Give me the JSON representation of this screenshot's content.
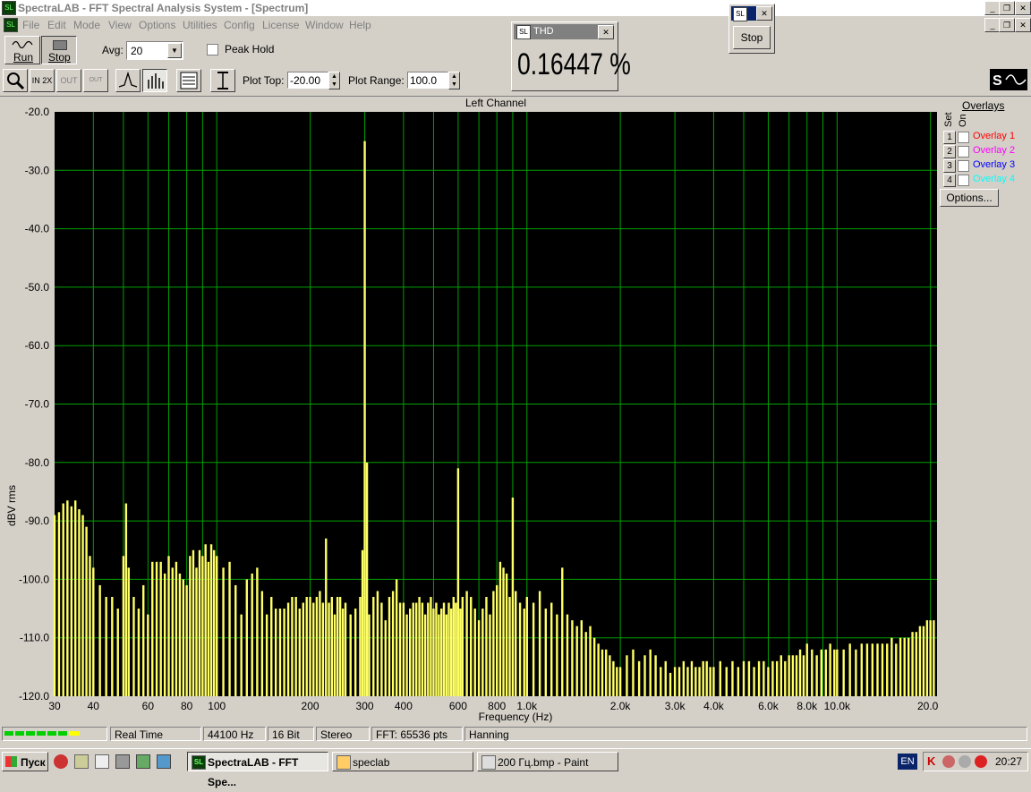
{
  "window": {
    "title": "SpectraLAB - FFT Spectral Analysis System - [Spectrum]"
  },
  "menu": [
    "File",
    "Edit",
    "Mode",
    "View",
    "Options",
    "Utilities",
    "Config",
    "License",
    "Window",
    "Help"
  ],
  "toolbar": {
    "run_label": "Run",
    "stop_label": "Stop",
    "avg_label": "Avg:",
    "avg_value": "20",
    "peak_hold_label": "Peak Hold",
    "plot_top_label": "Plot Top:",
    "plot_top_value": "-20.00",
    "plot_range_label": "Plot Range:",
    "plot_range_value": "100.0",
    "zoom_in_label": "IN 2X",
    "zoom_out_label": "OUT 2X",
    "zoom_full_label": "OUT FULL"
  },
  "thd_window": {
    "title": "THD",
    "value": "0.16447 %"
  },
  "stop_window": {
    "stop_label": "Stop"
  },
  "plot": {
    "channel_title": "Left Channel",
    "colors": {
      "background": "#000000",
      "grid": "#00a000",
      "bars": "#ffff66"
    }
  },
  "overlays": {
    "title": "Overlays",
    "set_label": "Set",
    "on_label": "On",
    "items": [
      {
        "num": "1",
        "label": "Overlay 1",
        "color": "#ff0000"
      },
      {
        "num": "2",
        "label": "Overlay 2",
        "color": "#ff00ff"
      },
      {
        "num": "3",
        "label": "Overlay 3",
        "color": "#0000ff"
      },
      {
        "num": "4",
        "label": "Overlay 4",
        "color": "#00ffff"
      }
    ],
    "options_label": "Options..."
  },
  "status": {
    "mode": "Real Time",
    "rate": "44100 Hz",
    "bits": "16 Bit",
    "channels": "Stereo",
    "fft": "FFT: 65536 pts",
    "window": "Hanning"
  },
  "taskbar": {
    "start": "Пуск",
    "tasks": [
      "SpectraLAB - FFT Spe...",
      "speclab",
      "200 Гц.bmp - Paint"
    ],
    "lang": "EN",
    "clock": "20:27"
  },
  "chart_data": {
    "type": "bar",
    "xscale": "log",
    "xlabel": "Frequency (Hz)",
    "ylabel": "dBV rms",
    "xlim": [
      30,
      21000
    ],
    "ylim": [
      -120,
      -20
    ],
    "grid": true,
    "yticks": [
      "-20.0",
      "-30.0",
      "-40.0",
      "-50.0",
      "-60.0",
      "-70.0",
      "-80.0",
      "-90.0",
      "-100.0",
      "-110.0",
      "-120.0"
    ],
    "xticks": [
      {
        "v": 30,
        "t": "30"
      },
      {
        "v": 40,
        "t": "40"
      },
      {
        "v": 60,
        "t": "60"
      },
      {
        "v": 80,
        "t": "80"
      },
      {
        "v": 100,
        "t": "100"
      },
      {
        "v": 200,
        "t": "200"
      },
      {
        "v": 300,
        "t": "300"
      },
      {
        "v": 400,
        "t": "400"
      },
      {
        "v": 600,
        "t": "600"
      },
      {
        "v": 800,
        "t": "800"
      },
      {
        "v": 1000,
        "t": "1.0k"
      },
      {
        "v": 2000,
        "t": "2.0k"
      },
      {
        "v": 3000,
        "t": "3.0k"
      },
      {
        "v": 4000,
        "t": "4.0k"
      },
      {
        "v": 6000,
        "t": "6.0k"
      },
      {
        "v": 8000,
        "t": "8.0k"
      },
      {
        "v": 10000,
        "t": "10.0k"
      },
      {
        "v": 20000,
        "t": "20.0k"
      }
    ],
    "bars": [
      [
        30,
        -89
      ],
      [
        31,
        -88.5
      ],
      [
        32,
        -87
      ],
      [
        33,
        -86.5
      ],
      [
        34,
        -87.5
      ],
      [
        35,
        -86.5
      ],
      [
        36,
        -88
      ],
      [
        37,
        -89
      ],
      [
        38,
        -91
      ],
      [
        39,
        -96
      ],
      [
        40,
        -98
      ],
      [
        42,
        -101
      ],
      [
        44,
        -103
      ],
      [
        46,
        -103
      ],
      [
        48,
        -105
      ],
      [
        50,
        -96
      ],
      [
        51,
        -87
      ],
      [
        52,
        -98
      ],
      [
        54,
        -103
      ],
      [
        56,
        -105
      ],
      [
        58,
        -101
      ],
      [
        60,
        -106
      ],
      [
        62,
        -97
      ],
      [
        64,
        -97
      ],
      [
        66,
        -97
      ],
      [
        68,
        -99
      ],
      [
        70,
        -96
      ],
      [
        72,
        -98
      ],
      [
        74,
        -97
      ],
      [
        76,
        -99
      ],
      [
        78,
        -100
      ],
      [
        80,
        -101
      ],
      [
        82,
        -96
      ],
      [
        84,
        -95
      ],
      [
        86,
        -98
      ],
      [
        88,
        -95
      ],
      [
        90,
        -96
      ],
      [
        92,
        -94
      ],
      [
        94,
        -97
      ],
      [
        96,
        -94
      ],
      [
        98,
        -95
      ],
      [
        100,
        -96
      ],
      [
        105,
        -98
      ],
      [
        110,
        -97
      ],
      [
        115,
        -101
      ],
      [
        120,
        -106
      ],
      [
        125,
        -100
      ],
      [
        130,
        -99
      ],
      [
        135,
        -98
      ],
      [
        140,
        -102
      ],
      [
        145,
        -106
      ],
      [
        150,
        -103
      ],
      [
        155,
        -105
      ],
      [
        160,
        -105
      ],
      [
        165,
        -105
      ],
      [
        170,
        -104
      ],
      [
        175,
        -103
      ],
      [
        180,
        -103
      ],
      [
        185,
        -105
      ],
      [
        190,
        -104
      ],
      [
        195,
        -103
      ],
      [
        200,
        -103
      ],
      [
        205,
        -104
      ],
      [
        210,
        -103
      ],
      [
        215,
        -102
      ],
      [
        220,
        -104
      ],
      [
        225,
        -93
      ],
      [
        230,
        -104
      ],
      [
        235,
        -103
      ],
      [
        240,
        -106
      ],
      [
        245,
        -103
      ],
      [
        250,
        -103
      ],
      [
        255,
        -105
      ],
      [
        260,
        -104
      ],
      [
        270,
        -106
      ],
      [
        280,
        -105
      ],
      [
        290,
        -103
      ],
      [
        295,
        -95
      ],
      [
        300,
        -25
      ],
      [
        305,
        -80
      ],
      [
        310,
        -106
      ],
      [
        320,
        -103
      ],
      [
        330,
        -102
      ],
      [
        340,
        -104
      ],
      [
        350,
        -107
      ],
      [
        360,
        -103
      ],
      [
        370,
        -102
      ],
      [
        380,
        -100
      ],
      [
        390,
        -104
      ],
      [
        400,
        -104
      ],
      [
        410,
        -106
      ],
      [
        420,
        -105
      ],
      [
        430,
        -104
      ],
      [
        440,
        -104
      ],
      [
        450,
        -103
      ],
      [
        460,
        -104
      ],
      [
        470,
        -106
      ],
      [
        480,
        -104
      ],
      [
        490,
        -103
      ],
      [
        500,
        -105
      ],
      [
        510,
        -104
      ],
      [
        520,
        -106
      ],
      [
        530,
        -105
      ],
      [
        540,
        -104
      ],
      [
        550,
        -106
      ],
      [
        560,
        -104
      ],
      [
        570,
        -105
      ],
      [
        580,
        -103
      ],
      [
        590,
        -104
      ],
      [
        600,
        -81
      ],
      [
        610,
        -105
      ],
      [
        620,
        -103
      ],
      [
        640,
        -102
      ],
      [
        660,
        -103
      ],
      [
        680,
        -105
      ],
      [
        700,
        -107
      ],
      [
        720,
        -105
      ],
      [
        740,
        -103
      ],
      [
        760,
        -106
      ],
      [
        780,
        -102
      ],
      [
        800,
        -101
      ],
      [
        820,
        -97
      ],
      [
        840,
        -98
      ],
      [
        860,
        -99
      ],
      [
        880,
        -103
      ],
      [
        900,
        -86
      ],
      [
        920,
        -102
      ],
      [
        950,
        -104
      ],
      [
        980,
        -105
      ],
      [
        1000,
        -103
      ],
      [
        1050,
        -104
      ],
      [
        1100,
        -102
      ],
      [
        1150,
        -105
      ],
      [
        1200,
        -104
      ],
      [
        1250,
        -106
      ],
      [
        1300,
        -98
      ],
      [
        1350,
        -106
      ],
      [
        1400,
        -107
      ],
      [
        1450,
        -108
      ],
      [
        1500,
        -107
      ],
      [
        1550,
        -109
      ],
      [
        1600,
        -108
      ],
      [
        1650,
        -110
      ],
      [
        1700,
        -111
      ],
      [
        1750,
        -112
      ],
      [
        1800,
        -112
      ],
      [
        1850,
        -113
      ],
      [
        1900,
        -114
      ],
      [
        1950,
        -115
      ],
      [
        2000,
        -115
      ],
      [
        2100,
        -113
      ],
      [
        2200,
        -112
      ],
      [
        2300,
        -114
      ],
      [
        2400,
        -113
      ],
      [
        2500,
        -112
      ],
      [
        2600,
        -113
      ],
      [
        2700,
        -115
      ],
      [
        2800,
        -114
      ],
      [
        2900,
        -116
      ],
      [
        3000,
        -115
      ],
      [
        3100,
        -115
      ],
      [
        3200,
        -114
      ],
      [
        3300,
        -115
      ],
      [
        3400,
        -114
      ],
      [
        3500,
        -115
      ],
      [
        3600,
        -115
      ],
      [
        3700,
        -114
      ],
      [
        3800,
        -114
      ],
      [
        3900,
        -115
      ],
      [
        4000,
        -115
      ],
      [
        4200,
        -114
      ],
      [
        4400,
        -115
      ],
      [
        4600,
        -114
      ],
      [
        4800,
        -115
      ],
      [
        5000,
        -114
      ],
      [
        5200,
        -114
      ],
      [
        5400,
        -115
      ],
      [
        5600,
        -114
      ],
      [
        5800,
        -114
      ],
      [
        6000,
        -115
      ],
      [
        6200,
        -114
      ],
      [
        6400,
        -114
      ],
      [
        6600,
        -113
      ],
      [
        6800,
        -114
      ],
      [
        7000,
        -113
      ],
      [
        7200,
        -113
      ],
      [
        7400,
        -113
      ],
      [
        7600,
        -112
      ],
      [
        7800,
        -113
      ],
      [
        8000,
        -111
      ],
      [
        8300,
        -112
      ],
      [
        8600,
        -113
      ],
      [
        8900,
        -112
      ],
      [
        9200,
        -112
      ],
      [
        9500,
        -111
      ],
      [
        9800,
        -112
      ],
      [
        10000,
        -112
      ],
      [
        10500,
        -112
      ],
      [
        11000,
        -111
      ],
      [
        11500,
        -112
      ],
      [
        12000,
        -111
      ],
      [
        12500,
        -111
      ],
      [
        13000,
        -111
      ],
      [
        13500,
        -111
      ],
      [
        14000,
        -111
      ],
      [
        14500,
        -111
      ],
      [
        15000,
        -110
      ],
      [
        15500,
        -111
      ],
      [
        16000,
        -110
      ],
      [
        16500,
        -110
      ],
      [
        17000,
        -110
      ],
      [
        17500,
        -109
      ],
      [
        18000,
        -109
      ],
      [
        18500,
        -108
      ],
      [
        19000,
        -108
      ],
      [
        19500,
        -107
      ],
      [
        20000,
        -107
      ],
      [
        20500,
        -107
      ]
    ]
  }
}
